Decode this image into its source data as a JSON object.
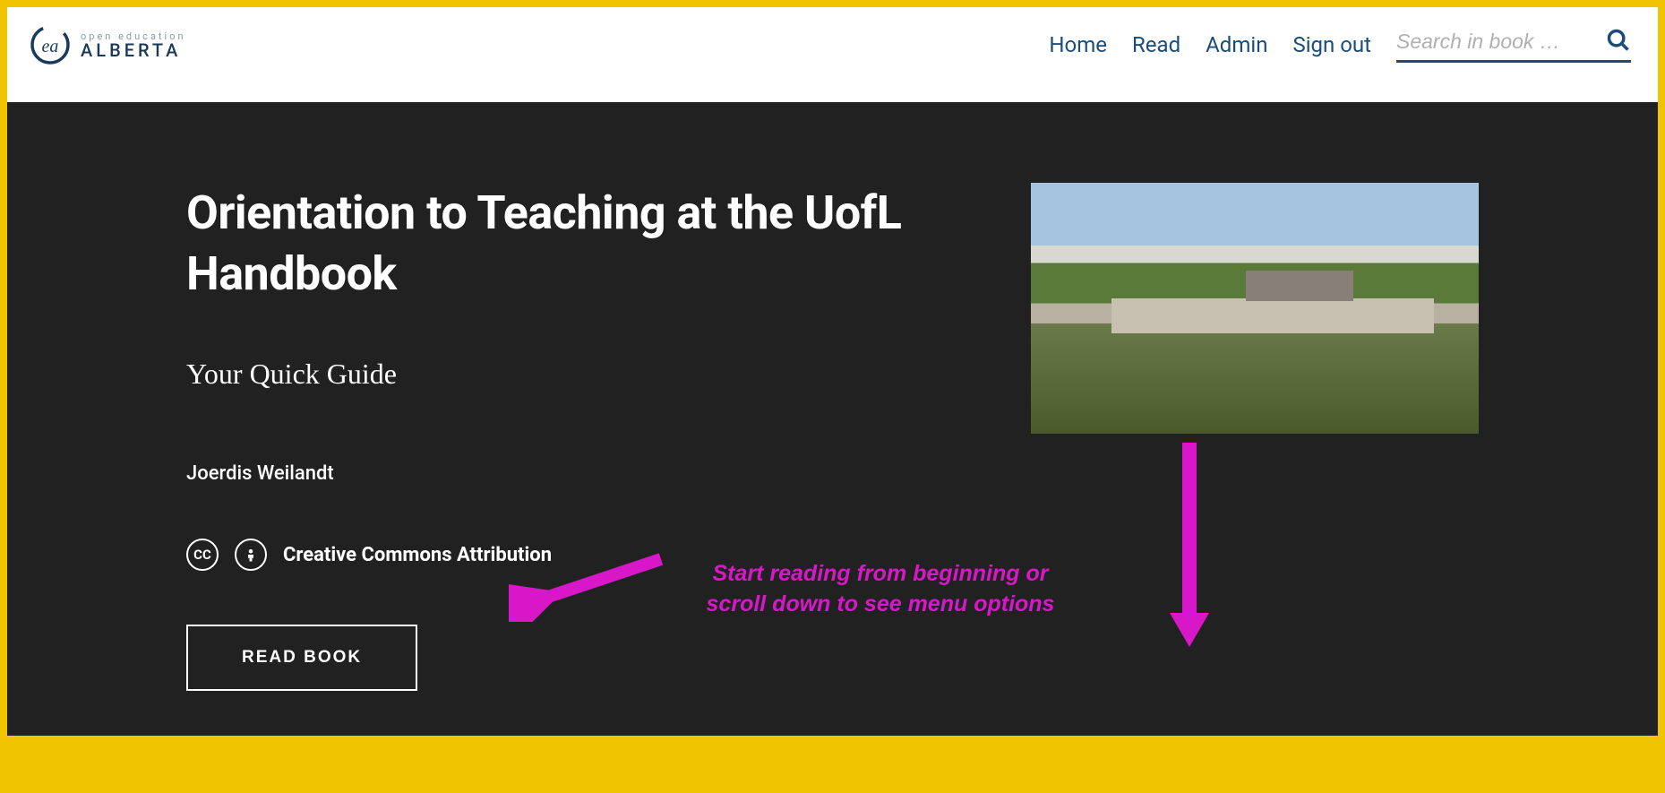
{
  "logo": {
    "sub": "open education",
    "main": "ALBERTA"
  },
  "nav": {
    "home": "Home",
    "read": "Read",
    "admin": "Admin",
    "signout": "Sign out"
  },
  "search": {
    "placeholder": "Search in book …"
  },
  "hero": {
    "title": "Orientation to Teaching at the UofL Handbook",
    "subtitle": "Your Quick Guide",
    "author": "Joerdis Weilandt",
    "cc_label": "CC",
    "license": "Creative Commons Attribution",
    "read_button": "READ BOOK"
  },
  "annotation": {
    "text": "Start reading from beginning or scroll down to see menu options"
  },
  "colors": {
    "border": "#f0c500",
    "nav_link": "#1a4d7a",
    "hero_bg": "#212121",
    "annotation": "#d817c9"
  }
}
